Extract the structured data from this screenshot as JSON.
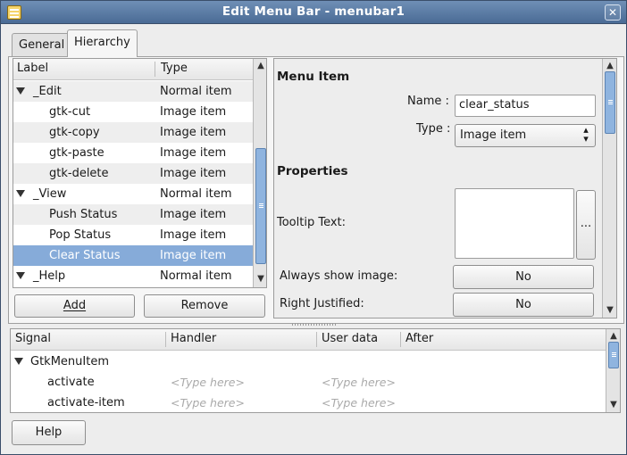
{
  "window": {
    "title": "Edit Menu Bar - menubar1",
    "close_glyph": "✕"
  },
  "tabs": [
    {
      "label": "General"
    },
    {
      "label": "Hierarchy"
    }
  ],
  "tree": {
    "columns": [
      "Label",
      "Type"
    ],
    "rows": [
      {
        "label": "_Edit",
        "type": "Normal item"
      },
      {
        "label": "gtk-cut",
        "type": "Image item"
      },
      {
        "label": "gtk-copy",
        "type": "Image item"
      },
      {
        "label": "gtk-paste",
        "type": "Image item"
      },
      {
        "label": "gtk-delete",
        "type": "Image item"
      },
      {
        "label": "_View",
        "type": "Normal item"
      },
      {
        "label": "Push Status",
        "type": "Image item"
      },
      {
        "label": "Pop Status",
        "type": "Image item"
      },
      {
        "label": "Clear Status",
        "type": "Image item"
      },
      {
        "label": "_Help",
        "type": "Normal item"
      }
    ]
  },
  "buttons": {
    "add": "Add",
    "remove": "Remove",
    "help": "Help"
  },
  "properties": {
    "menu_item_heading": "Menu Item",
    "name_label": "Name :",
    "name_value": "clear_status",
    "type_label": "Type :",
    "type_value": "Image item",
    "properties_heading": "Properties",
    "tooltip_label": "Tooltip Text:",
    "tooltip_button": "...",
    "always_show_image_label": "Always show image:",
    "always_show_image_value": "No",
    "right_justified_label": "Right Justified:",
    "right_justified_value": "No"
  },
  "signals": {
    "columns": [
      "Signal",
      "Handler",
      "User data",
      "After"
    ],
    "group": "GtkMenuItem",
    "rows": [
      {
        "signal": "activate",
        "handler": "<Type here>",
        "user_data": "<Type here>"
      },
      {
        "signal": "activate-item",
        "handler": "<Type here>",
        "user_data": "<Type here>"
      }
    ]
  },
  "colors": {
    "selection": "#86abd9",
    "titlebar": "#4a6b95"
  }
}
